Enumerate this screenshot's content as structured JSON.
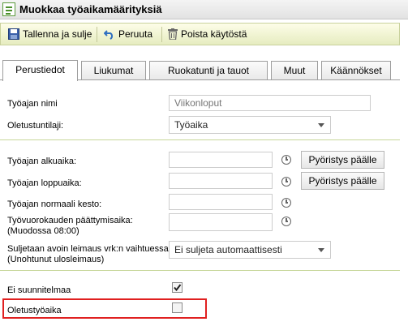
{
  "window": {
    "title": "Muokkaa työaikamäärityksiä"
  },
  "toolbar": {
    "save_label": "Tallenna ja sulje",
    "cancel_label": "Peruuta",
    "disable_label": "Poista käytöstä"
  },
  "tabs": [
    {
      "label": "Perustiedot"
    },
    {
      "label": "Liukumat"
    },
    {
      "label": "Ruokatunti ja tauot"
    },
    {
      "label": "Muut"
    },
    {
      "label": "Käännökset"
    }
  ],
  "form": {
    "name_label": "Työajan nimi",
    "name_placeholder": "Viikonloput",
    "type_label": "Oletustuntilaji:",
    "type_value": "Työaika",
    "start_label": "Työajan alkuaika:",
    "end_label": "Työajan loppuaika:",
    "normal_label": "Työajan normaali kesto:",
    "shift_end_label": "Työvuorokauden päättymisaika:",
    "shift_end_hint": "(Muodossa 08:00)",
    "rounding_label": "Pyöristys päälle",
    "close_label": "Suljetaan avoin leimaus vrk:n vaihtuessa:",
    "close_hint": "(Unohtunut ulosleimaus)",
    "close_value": "Ei suljeta automaattisesti",
    "no_plan_label": "Ei suunnitelmaa",
    "no_plan_checked": true,
    "default_label": "Oletustyöaika",
    "default_checked": false
  },
  "colors": {
    "highlight": "#e02020",
    "toolbar_bg": "#eef2d0",
    "separator": "#c7d79a"
  }
}
